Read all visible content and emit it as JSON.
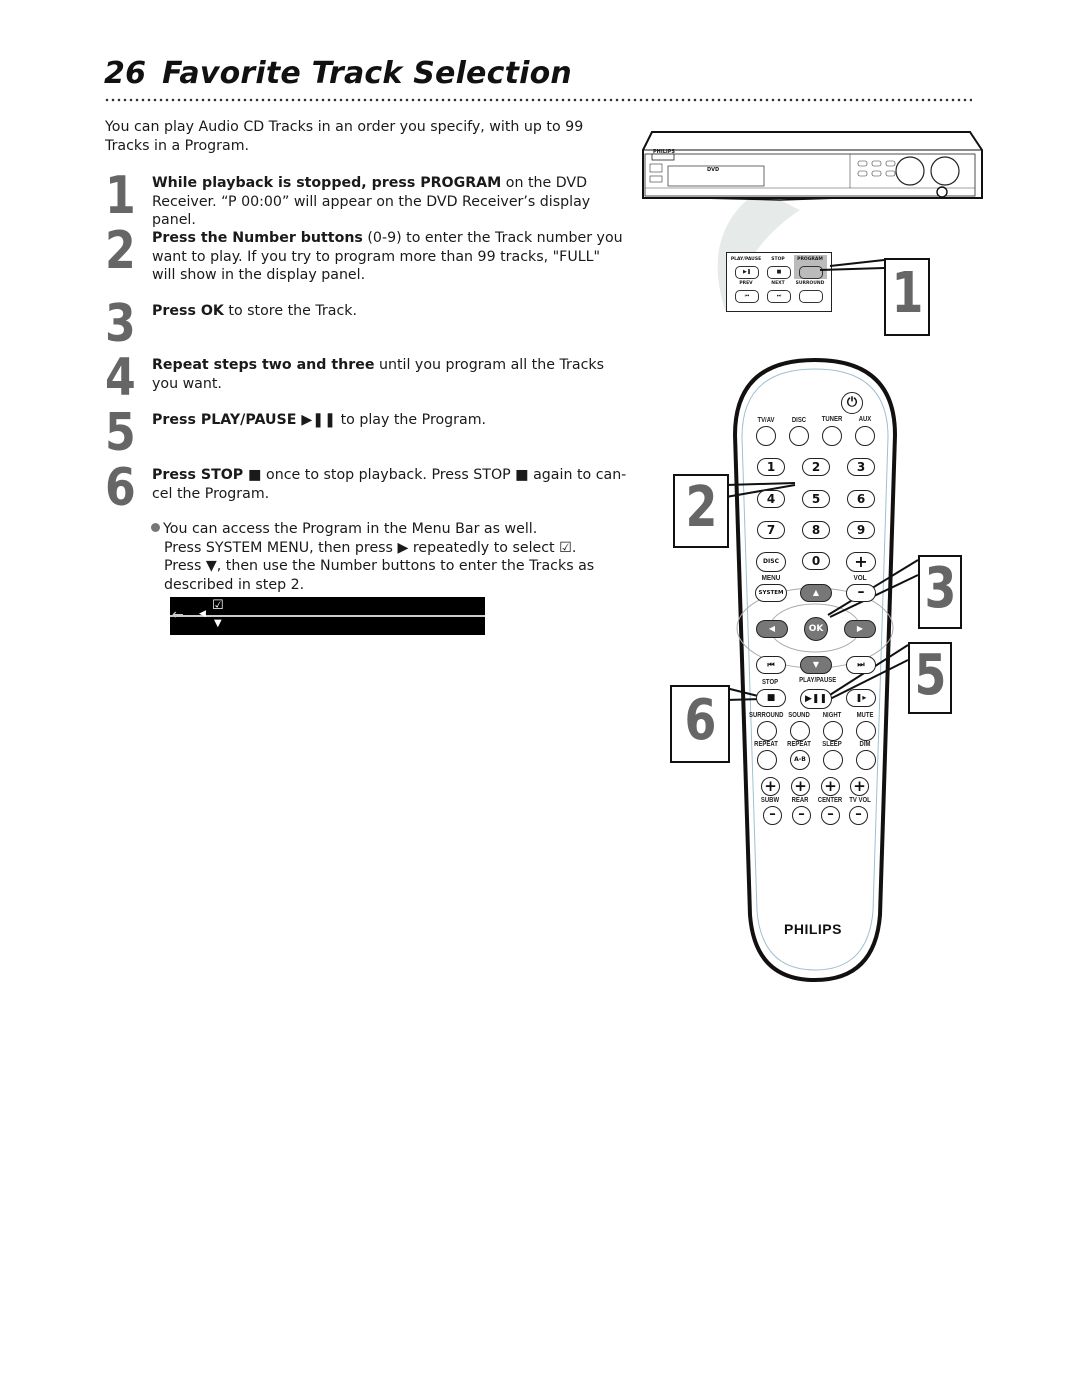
{
  "page": {
    "page_number": "26",
    "title": "Favorite Track Selection"
  },
  "intro": "You can play Audio CD Tracks in an order you specify, with up to 99 Tracks in a Program.",
  "steps": [
    {
      "number": "1",
      "bold": "While playback is stopped, press PROGRAM",
      "text": " on the DVD Receiver. “P 00:00” will appear on the DVD Receiver’s display panel."
    },
    {
      "number": "2",
      "bold": "Press the Number buttons",
      "text": " (0-9) to enter the Track number you want to play. If you try to program more than 99 tracks, \"FULL\" will show in the display panel."
    },
    {
      "number": "3",
      "bold": "Press OK",
      "text": " to store the Track."
    },
    {
      "number": "4",
      "bold": "Repeat steps two and three",
      "text": " until you program all the Tracks you want."
    },
    {
      "number": "5",
      "bold": "Press PLAY/PAUSE ▶❚❚",
      "text": " to play the Program."
    },
    {
      "number": "6",
      "bold": "Press STOP ■",
      "text": " once to stop playback. Press STOP ■ again to can- cel the Program."
    }
  ],
  "note": {
    "line1": "You can access the Program in the Menu Bar as well.",
    "line2": "Press SYSTEM MENU, then press ▶ repeatedly to select ☑.",
    "line3": "Press ▼, then use the Number buttons to enter the Tracks as",
    "line4": "described in step 2."
  },
  "menu_bar": {
    "back_icon": "←",
    "left_icon": "◀",
    "program_icon": "☑",
    "down_icon": "▼"
  },
  "receiver": {
    "brand": "PHILIPS",
    "disc_label": "DVD",
    "panel_buttons": [
      {
        "label": "PLAY/PAUSE",
        "glyph": "▶❚"
      },
      {
        "label": "STOP",
        "glyph": "■"
      },
      {
        "label": "PROGRAM",
        "glyph": ""
      },
      {
        "label": "PREV",
        "glyph": "⏮"
      },
      {
        "label": "NEXT",
        "glyph": "⏭"
      },
      {
        "label": "SURROUND",
        "glyph": ""
      }
    ]
  },
  "callouts": [
    "1",
    "2",
    "3",
    "5",
    "6"
  ],
  "remote": {
    "power_icon": "⏻",
    "source_labels": [
      "TV/AV",
      "DISC",
      "TUNER",
      "AUX"
    ],
    "numbers": [
      "1",
      "2",
      "3",
      "4",
      "5",
      "6",
      "7",
      "8",
      "9",
      "0"
    ],
    "disc_label": "DISC",
    "menu_label": "MENU",
    "system_label": "SYSTEM",
    "vol_label": "VOL",
    "plus": "+",
    "minus": "–",
    "ok_label": "OK",
    "up": "▲",
    "down": "▼",
    "left": "◀",
    "right": "▶",
    "prev": "⏮",
    "next": "⏭",
    "stop_label": "STOP",
    "stop_glyph": "■",
    "playpause_label": "PLAY/PAUSE",
    "playpause_glyph": "▶❚❚",
    "slow_glyph": "❚▸",
    "row_labels_1": [
      "SURROUND",
      "SOUND",
      "NIGHT",
      "MUTE"
    ],
    "row_labels_2": [
      "REPEAT",
      "REPEAT",
      "SLEEP",
      "DIM"
    ],
    "ab_label": "A-B",
    "level_labels": [
      "SUBW",
      "REAR",
      "CENTER",
      "TV VOL"
    ],
    "brand": "PHILIPS"
  }
}
